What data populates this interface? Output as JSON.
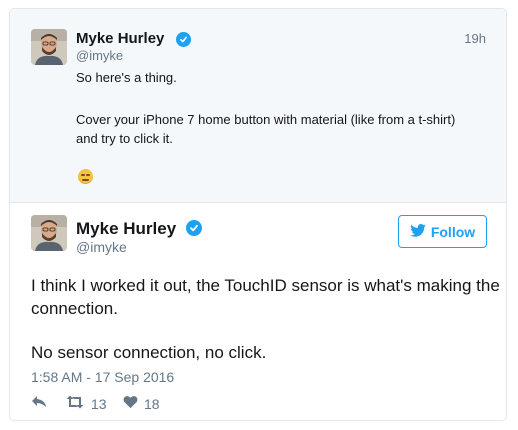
{
  "parent_tweet": {
    "author_name": "Myke Hurley",
    "author_handle": "@imyke",
    "time_ago": "19h",
    "lines": [
      "So here's a thing.",
      "Cover your iPhone 7 home button with material (like from a t-shirt)",
      "and try to click it."
    ],
    "emoji": "expressionless-face"
  },
  "main_tweet": {
    "author_name": "Myke Hurley",
    "author_handle": "@imyke",
    "follow_label": "Follow",
    "lines": [
      "I think I worked it out, the TouchID sensor is what's making the",
      "connection.",
      "No sensor connection, no click."
    ],
    "timestamp": "1:58 AM - 17 Sep 2016",
    "retweet_count": "13",
    "like_count": "18"
  },
  "colors": {
    "accent": "#1da1f2",
    "secondary_text": "#657786",
    "parent_background": "#f5f8fa",
    "border": "#e1e8ed"
  },
  "icons": [
    "verified-icon",
    "reply-icon",
    "retweet-icon",
    "heart-icon",
    "twitter-bird-icon"
  ]
}
